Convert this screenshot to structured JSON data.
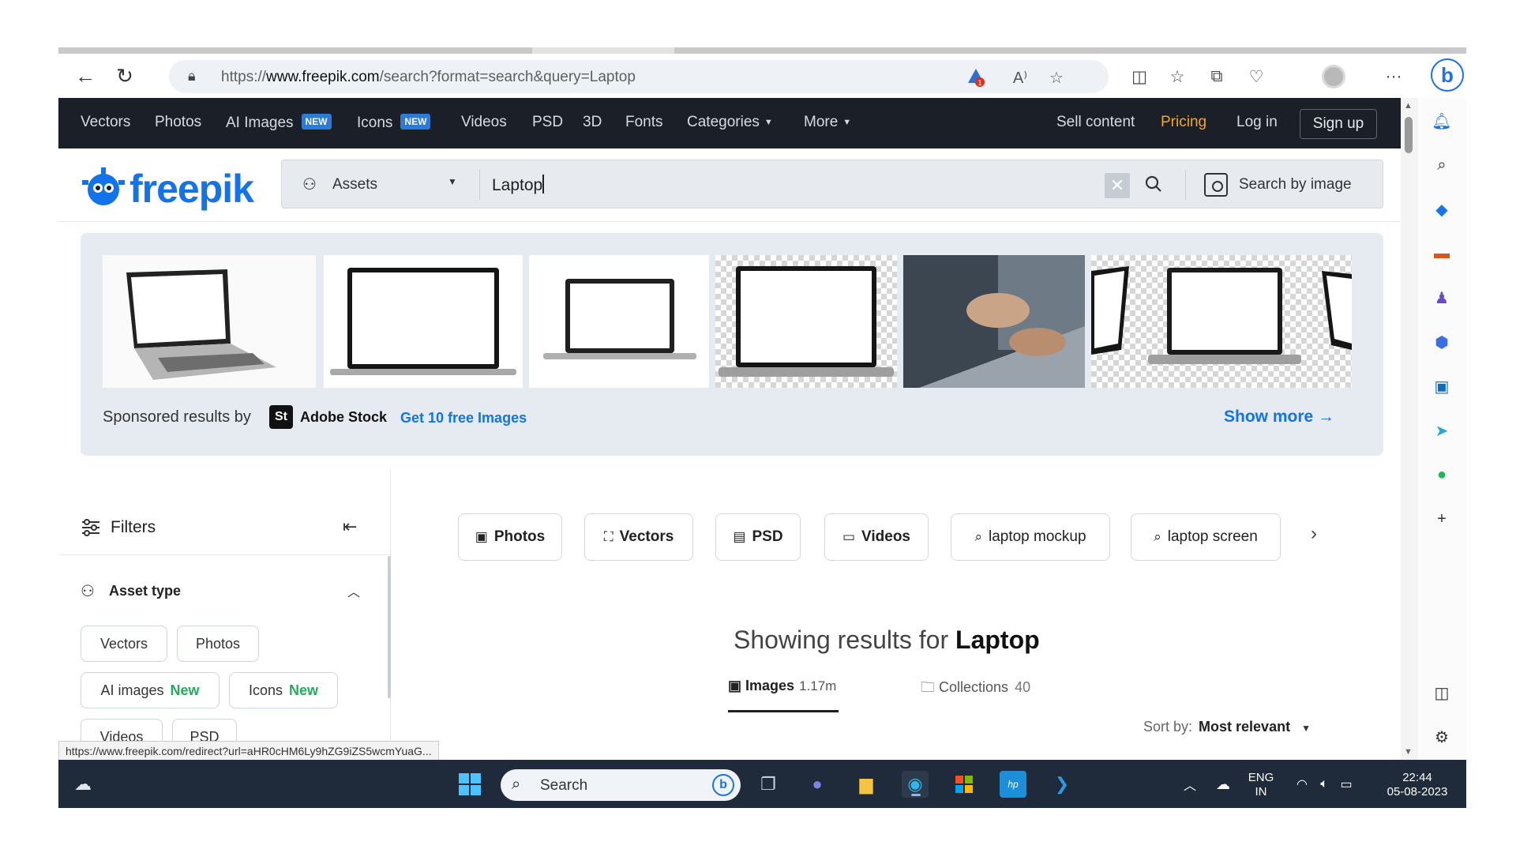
{
  "browser": {
    "url_prefix": "https://",
    "url_host": "www.freepik.com",
    "url_path": "/search?format=search&query=Laptop",
    "notification_count": "1"
  },
  "topnav": {
    "items": [
      "Vectors",
      "Photos",
      "AI Images",
      "Icons",
      "Videos",
      "PSD",
      "3D",
      "Fonts",
      "Categories",
      "More"
    ],
    "new_badge": "NEW",
    "sell": "Sell content",
    "pricing": "Pricing",
    "login": "Log in",
    "signup": "Sign up"
  },
  "logo": {
    "text": "freepik",
    "color": "#1273eb"
  },
  "search": {
    "scope": "Assets",
    "query": "Laptop",
    "by_image": "Search by image"
  },
  "sponsored": {
    "label": "Sponsored results by",
    "brand_badge": "St",
    "brand": "Adobe Stock",
    "free_link": "Get 10 free Images",
    "show_more": "Show more"
  },
  "filters": {
    "title": "Filters",
    "asset_type_title": "Asset type",
    "new_label": "New",
    "chips": [
      "Vectors",
      "Photos",
      "AI images",
      "Icons",
      "Videos",
      "PSD"
    ]
  },
  "related": {
    "chips": [
      "Photos",
      "Vectors",
      "PSD",
      "Videos",
      "laptop mockup",
      "laptop screen"
    ]
  },
  "results": {
    "prefix": "Showing results for",
    "query": "Laptop",
    "tabs": [
      {
        "label": "Images",
        "count": "1.17m"
      },
      {
        "label": "Collections",
        "count": "40"
      }
    ],
    "sort_label": "Sort by:",
    "sort_value": "Most relevant"
  },
  "status_url": "https://www.freepik.com/redirect?url=aHR0cHM6Ly9hZG9iZS5wcmYuaG...",
  "taskbar": {
    "search_placeholder": "Search",
    "lang": "ENG",
    "region": "IN",
    "time": "22:44",
    "date": "05-08-2023"
  },
  "colors": {
    "accent": "#1273eb",
    "pricing": "#f5a623",
    "new": "#1fad5a",
    "nav_bg": "#1b2028"
  }
}
